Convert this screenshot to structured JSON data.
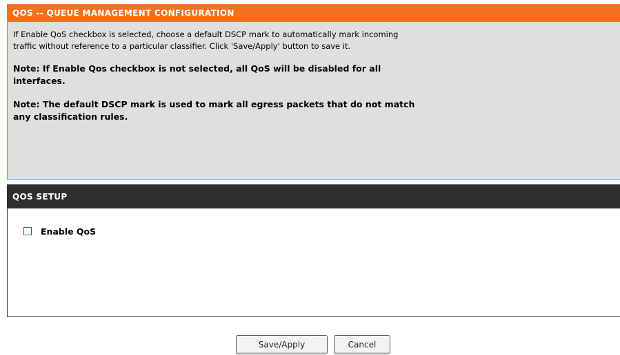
{
  "queue_management": {
    "title": "QOS -- QUEUE MANAGEMENT CONFIGURATION",
    "description": "If Enable QoS checkbox is selected, choose a default DSCP mark to automatically mark incoming traffic without reference to a particular classifier. Click 'Save/Apply' button to save it.",
    "note_1": "Note: If Enable Qos checkbox is not selected, all QoS will be disabled for all interfaces.",
    "note_2": "Note: The default DSCP mark is used to mark all egress packets that do not match any classification rules."
  },
  "qos_setup": {
    "title": "QOS SETUP",
    "enable_qos_label": "Enable QoS",
    "enable_qos_checked": false
  },
  "buttons": {
    "save_label": "Save/Apply",
    "cancel_label": "Cancel"
  },
  "colors": {
    "accent_orange": "#f37021",
    "panel_gray": "#dfdfdf",
    "dark_header": "#2f2f2f"
  }
}
